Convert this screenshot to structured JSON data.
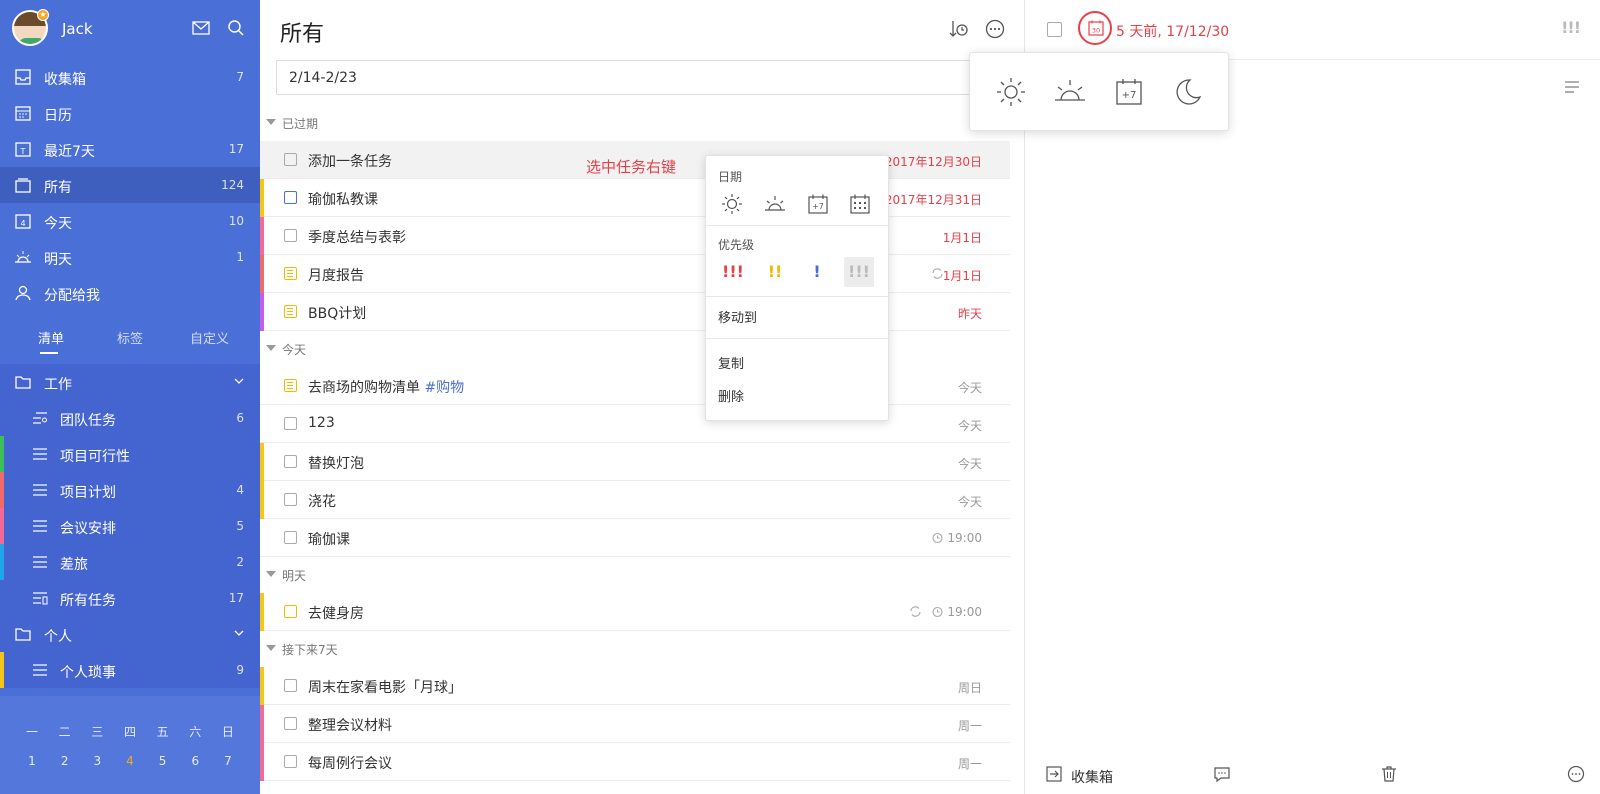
{
  "user": {
    "name": "Jack",
    "badge": "★"
  },
  "nav": [
    {
      "label": "收集箱",
      "count": "7",
      "icon": "inbox-icon"
    },
    {
      "label": "日历",
      "count": "",
      "icon": "calendar-icon"
    },
    {
      "label": "最近7天",
      "count": "17",
      "icon": "week-icon"
    },
    {
      "label": "所有",
      "count": "124",
      "icon": "all-icon"
    },
    {
      "label": "今天",
      "count": "10",
      "icon": "today-icon"
    },
    {
      "label": "明天",
      "count": "1",
      "icon": "tomorrow-icon"
    },
    {
      "label": "分配给我",
      "count": "",
      "icon": "assigned-icon"
    }
  ],
  "sidebar_tabs": [
    "清单",
    "标签",
    "自定义"
  ],
  "lists": {
    "work": {
      "label": "工作",
      "items": [
        {
          "label": "团队任务",
          "count": "6",
          "color": ""
        },
        {
          "label": "项目可行性",
          "count": "",
          "color": "#3fbf5a"
        },
        {
          "label": "项目计划",
          "count": "4",
          "color": "#f06a6a"
        },
        {
          "label": "会议安排",
          "count": "5",
          "color": "#f06a9a"
        },
        {
          "label": "差旅",
          "count": "2",
          "color": "#1ea7e8"
        },
        {
          "label": "所有任务",
          "count": "17",
          "color": ""
        }
      ]
    },
    "personal": {
      "label": "个人",
      "items": [
        {
          "label": "个人琐事",
          "count": "9",
          "color": "#f5c518"
        }
      ]
    }
  },
  "calendar": {
    "weekdays": [
      "一",
      "二",
      "三",
      "四",
      "五",
      "六",
      "日"
    ],
    "days": [
      "1",
      "2",
      "3",
      "4",
      "5",
      "6",
      "7"
    ]
  },
  "main": {
    "title": "所有",
    "search_value": "2/14-2/23",
    "groups": {
      "overdue": "已过期",
      "today": "今天",
      "tomorrow": "明天",
      "next7": "接下来7天"
    },
    "tasks": {
      "overdue": [
        {
          "title": "添加一条任务",
          "due": "2017年12月30日"
        },
        {
          "title": "瑜伽私教课",
          "due": "2017年12月31日"
        },
        {
          "title": "季度总结与表彰",
          "due": "1月1日"
        },
        {
          "title": "月度报告",
          "due": "1月1日"
        },
        {
          "title": "BBQ计划",
          "due": "昨天"
        }
      ],
      "today": [
        {
          "title": "去商场的购物清单 ",
          "tag": "#购物",
          "due": "今天"
        },
        {
          "title": "123",
          "due": "今天"
        },
        {
          "title": "替换灯泡",
          "due": "今天"
        },
        {
          "title": "浇花",
          "due": "今天"
        },
        {
          "title": "瑜伽课",
          "due": "19:00"
        }
      ],
      "tomorrow": [
        {
          "title": "去健身房",
          "due": "19:00"
        }
      ],
      "next7": [
        {
          "title": "周末在家看电影「月球」",
          "due": "周日"
        },
        {
          "title": "整理会议材料",
          "due": "周一"
        },
        {
          "title": "每周例行会议",
          "due": "周一"
        }
      ]
    },
    "annotation": "选中任务右键"
  },
  "context_menu": {
    "date_header": "日期",
    "priority_header": "优先级",
    "priorities": [
      "!!!",
      "!!",
      "!",
      "!!!"
    ],
    "move_to": "移动到",
    "copy": "复制",
    "delete": "删除"
  },
  "detail": {
    "date_text": "5 天前, 17/12/30",
    "priority_glyph": "!!!",
    "project": "收集箱"
  },
  "colors": {
    "sidebar": "#4a6fd6",
    "accent_red": "#e8404a",
    "high": "#e8404a",
    "medium": "#f5b800",
    "low": "#4a6fd6"
  }
}
